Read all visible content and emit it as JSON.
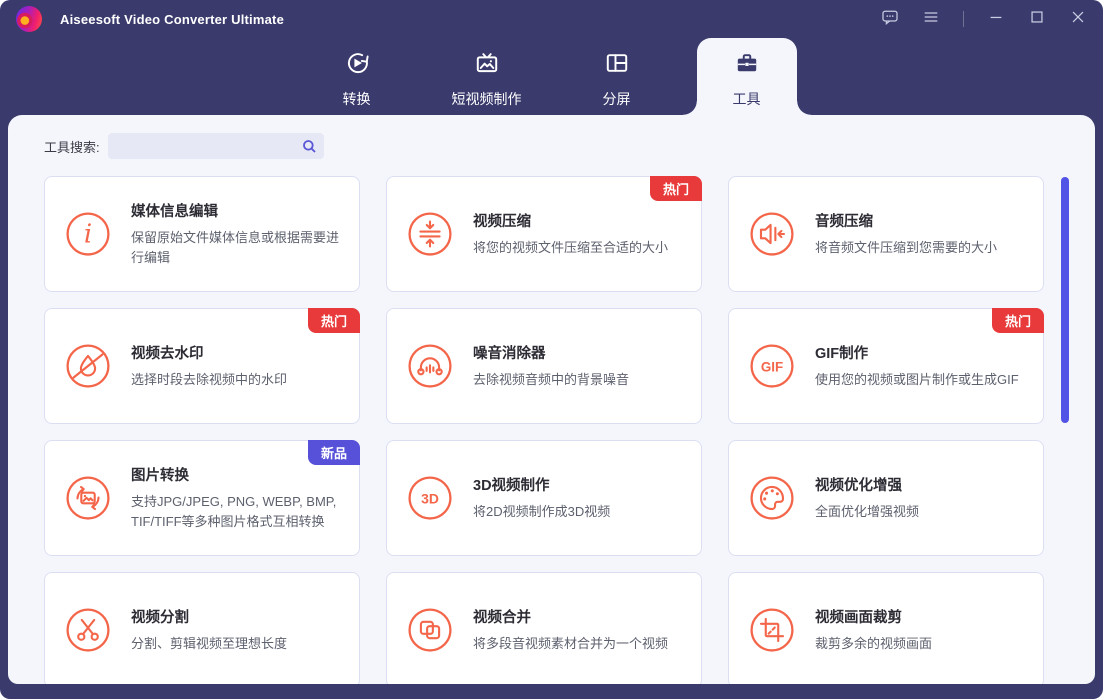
{
  "titlebar": {
    "title": "Aiseesoft Video Converter Ultimate",
    "controls": [
      {
        "name": "feedback-button",
        "icon": "feedback-icon"
      },
      {
        "name": "menu-button",
        "icon": "menu-icon"
      },
      {
        "name": "minimize-button",
        "icon": "minimize-icon"
      },
      {
        "name": "maximize-button",
        "icon": "maximize-icon"
      },
      {
        "name": "close-button",
        "icon": "close-icon"
      }
    ]
  },
  "tabs": [
    {
      "label": "转换",
      "icon": "convert-icon",
      "active": false
    },
    {
      "label": "短视频制作",
      "icon": "movie-maker-icon",
      "active": false
    },
    {
      "label": "分屏",
      "icon": "collage-icon",
      "active": false
    },
    {
      "label": "工具",
      "icon": "toolbox-icon",
      "active": true
    }
  ],
  "search": {
    "label": "工具搜索:",
    "value": "",
    "icon": "search-icon"
  },
  "badges": {
    "hot": "热门",
    "new": "新品"
  },
  "tools": [
    {
      "title": "媒体信息编辑",
      "desc": "保留原始文件媒体信息或根据需要进行编辑",
      "icon": "info-icon",
      "badge": null
    },
    {
      "title": "视频压缩",
      "desc": "将您的视频文件压缩至合适的大小",
      "icon": "compress-icon",
      "badge": "hot"
    },
    {
      "title": "音频压缩",
      "desc": "将音频文件压缩到您需要的大小",
      "icon": "audio-compress-icon",
      "badge": null
    },
    {
      "title": "视频去水印",
      "desc": "选择时段去除视频中的水印",
      "icon": "watermark-remove-icon",
      "badge": "hot"
    },
    {
      "title": "噪音消除器",
      "desc": "去除视频音频中的背景噪音",
      "icon": "noise-remover-icon",
      "badge": null
    },
    {
      "title": "GIF制作",
      "desc": "使用您的视频或图片制作或生成GIF",
      "icon": "gif-icon",
      "badge": "hot"
    },
    {
      "title": "图片转换",
      "desc": "支持JPG/JPEG, PNG, WEBP, BMP, TIF/TIFF等多种图片格式互相转换",
      "icon": "image-convert-icon",
      "badge": "new"
    },
    {
      "title": "3D视频制作",
      "desc": "将2D视频制作成3D视频",
      "icon": "3d-icon",
      "badge": null
    },
    {
      "title": "视频优化增强",
      "desc": "全面优化增强视频",
      "icon": "enhance-icon",
      "badge": null
    },
    {
      "title": "视频分割",
      "desc": "分割、剪辑视频至理想长度",
      "icon": "split-icon",
      "badge": null
    },
    {
      "title": "视频合并",
      "desc": "将多段音视频素材合并为一个视频",
      "icon": "merge-icon",
      "badge": null
    },
    {
      "title": "视频画面裁剪",
      "desc": "裁剪多余的视频画面",
      "icon": "crop-icon",
      "badge": null
    }
  ],
  "colors": {
    "frame": "#3a3a6d",
    "surface": "#f4f6fb",
    "accent": "#f4664a",
    "hot": "#e83a3a",
    "new": "#5750d9",
    "scrollbar": "#5153e6",
    "search-icon": "#5b57d6"
  }
}
